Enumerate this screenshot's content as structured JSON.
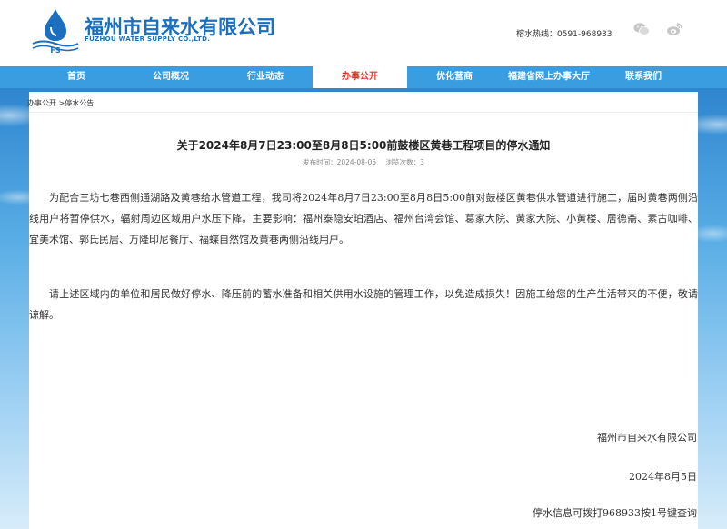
{
  "header": {
    "brand_cn": "福州市自来水有限公司",
    "brand_en": "FUZHOU WATER SUPPLY CO.,LTD.",
    "logo_letters": "FS",
    "hotline": "榕水热线：0591-968933",
    "brand_color": "#1a6fbf"
  },
  "nav": {
    "items": [
      {
        "label": "首页"
      },
      {
        "label": "公司概况"
      },
      {
        "label": "行业动态"
      },
      {
        "label": "办事公开",
        "active": true
      },
      {
        "label": "优化营商"
      },
      {
        "label": "福建省网上办事大厅"
      },
      {
        "label": "联系我们"
      }
    ],
    "bg_color": "#3a9de0",
    "active_color": "#e0382b"
  },
  "breadcrumb": "办事公开 >停水公告",
  "article": {
    "title": "关于2024年8月7日23:00至8月8日5:00前鼓楼区黄巷工程项目的停水通知",
    "publish_time": "发布时间：2024-08-05",
    "views": "浏览次数：3",
    "paragraphs": [
      "为配合三坊七巷西侧通湖路及黄巷给水管道工程，我司将2024年8月7日23:00至8月8日5:00前对鼓楼区黄巷供水管道进行施工，届时黄巷两侧沿线用户将暂停供水，辐射周边区域用户水压下降。主要影响：福州泰隐安珀酒店、福州台湾会馆、葛家大院、黄家大院、小黄楼、居德斋、素古咖啡、宜美术馆、郭氏民居、万隆印尼餐厅、福蝶自然馆及黄巷两侧沿线用户。",
      "请上述区域内的单位和居民做好停水、降压前的蓄水准备和相关供用水设施的管理工作，以免造成损失！因施工给您的生产生活带来的不便，敬请谅解。"
    ],
    "signature": "福州市自来水有限公司",
    "date": "2024年8月5日",
    "footer_note": "停水信息可拨打968933按1号键查询"
  },
  "icons": {
    "wechat": "wechat-icon",
    "weibo": "weibo-icon"
  }
}
